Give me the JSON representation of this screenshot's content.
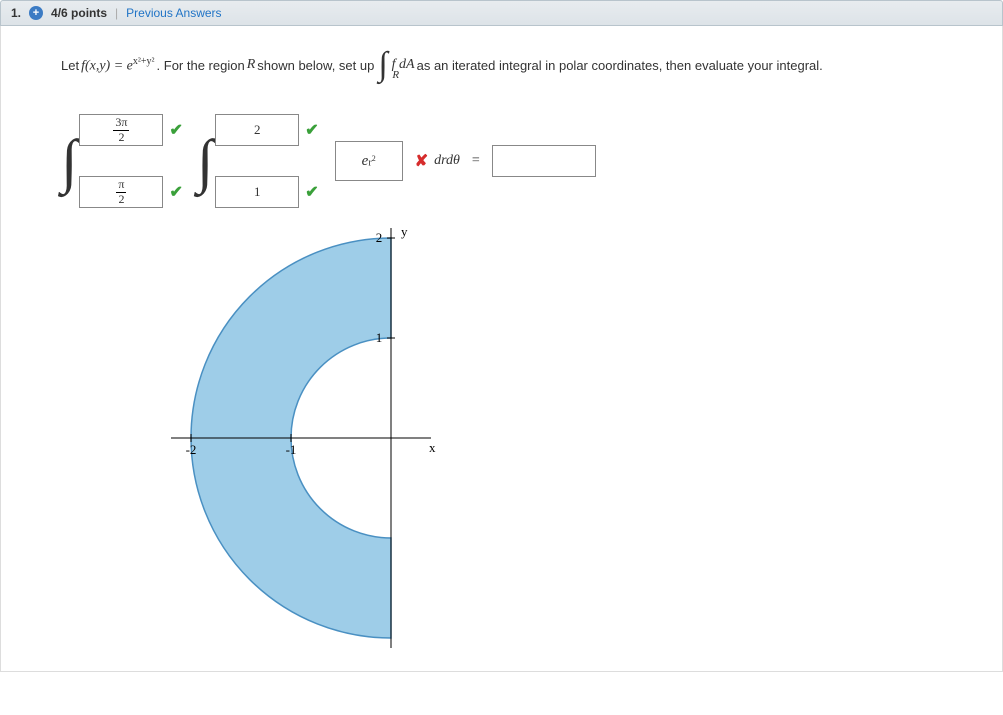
{
  "header": {
    "number": "1.",
    "points": "4/6 points",
    "prev_link": "Previous Answers"
  },
  "prompt": {
    "p1": "Let ",
    "fxy": "f(x,y) = e",
    "exp": "x²+y²",
    "p2": ". For the region ",
    "R": "R",
    "p3": " shown below, set up ",
    "intsub": "R",
    "fdA": "f dA",
    "p4": " as an iterated integral in polar coordinates, then evaluate your integral."
  },
  "answers": {
    "outer_upper_num": "3π",
    "outer_upper_den": "2",
    "outer_lower_num": "π",
    "outer_lower_den": "2",
    "inner_upper": "2",
    "inner_lower": "1",
    "integrand_base": "e",
    "integrand_exp": "r",
    "integrand_exp2": "2",
    "drdtheta": "drdθ",
    "equals": "=",
    "result": ""
  },
  "marks": {
    "correct": "✔",
    "wrong": "✘"
  },
  "graph": {
    "x_label": "x",
    "y_label": "y",
    "ticks_x": [
      "-2",
      "-1"
    ],
    "ticks_y": [
      "1",
      "2"
    ]
  },
  "chart_data": {
    "type": "region-plot",
    "description": "Left half-annulus between circles of radius 1 and 2, centered at origin",
    "r_inner": 1,
    "r_outer": 2,
    "theta_start_rad": 1.5708,
    "theta_end_rad": 4.7124,
    "x_range": [
      -2,
      0
    ],
    "y_range": [
      -2,
      2
    ],
    "x_ticks": [
      -2,
      -1
    ],
    "y_ticks": [
      1,
      2
    ],
    "xlabel": "x",
    "ylabel": "y",
    "fill_color": "#9ecde8",
    "stroke_color": "#4a90c2"
  }
}
